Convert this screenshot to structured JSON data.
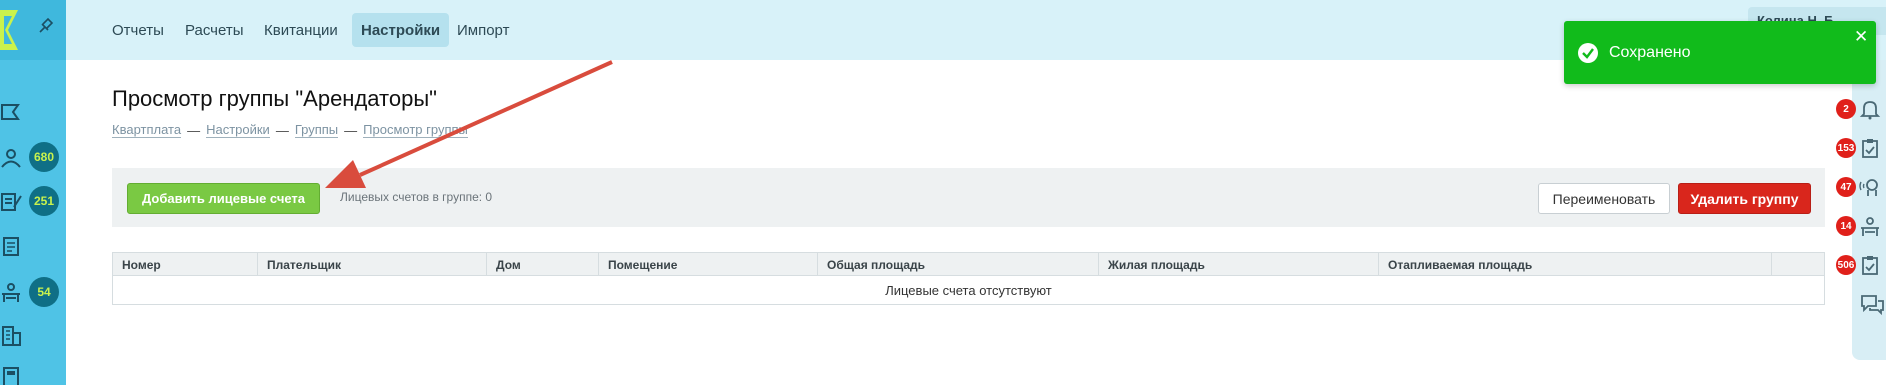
{
  "app": {
    "accent_color": "#4fc3e6",
    "success_color": "#11bb1b",
    "danger_color": "#d9261c",
    "primary_button_color": "#7ac943"
  },
  "sidebar": {
    "items": [
      {
        "icon": "flag-icon",
        "badge": ""
      },
      {
        "icon": "people-icon",
        "badge": "680"
      },
      {
        "icon": "edit-list-icon",
        "badge": "251"
      },
      {
        "icon": "documents-icon",
        "badge": ""
      },
      {
        "icon": "desk-person-icon",
        "badge": "54"
      },
      {
        "icon": "building-icon",
        "badge": ""
      },
      {
        "icon": "calculator-icon",
        "badge": ""
      }
    ]
  },
  "nav": {
    "items": [
      {
        "label": "Отчеты",
        "active": false
      },
      {
        "label": "Расчеты",
        "active": false
      },
      {
        "label": "Квитанции",
        "active": false
      },
      {
        "label": "Настройки",
        "active": true
      },
      {
        "label": "Импорт",
        "active": false
      }
    ],
    "user_name": "Колина Н. Б."
  },
  "page": {
    "title": "Просмотр группы \"Арендаторы\"",
    "breadcrumb": [
      "Квартплата",
      "Настройки",
      "Группы",
      "Просмотр группы"
    ],
    "breadcrumb_sep": "—"
  },
  "actions": {
    "add_label": "Добавить лицевые счета",
    "count_label": "Лицевых счетов в группе: 0",
    "rename_label": "Переименовать",
    "delete_label": "Удалить группу"
  },
  "table": {
    "columns": [
      "Номер",
      "Плательщик",
      "Дом",
      "Помещение",
      "Общая площадь",
      "Жилая площадь",
      "Отапливаемая площадь",
      ""
    ],
    "empty_text": "Лицевые счета отсутствуют"
  },
  "right_rail": {
    "items": [
      {
        "icon": "bell-icon",
        "badge": "2"
      },
      {
        "icon": "clipboard-check-icon",
        "badge": "153"
      },
      {
        "icon": "speaking-head-icon",
        "badge": "47"
      },
      {
        "icon": "desk-person-icon",
        "badge": "14"
      },
      {
        "icon": "clipboard-check-icon",
        "badge": "506"
      },
      {
        "icon": "chat-bubbles-icon",
        "badge": ""
      }
    ]
  },
  "toast": {
    "message": "Сохранено",
    "close_glyph": "✕"
  }
}
